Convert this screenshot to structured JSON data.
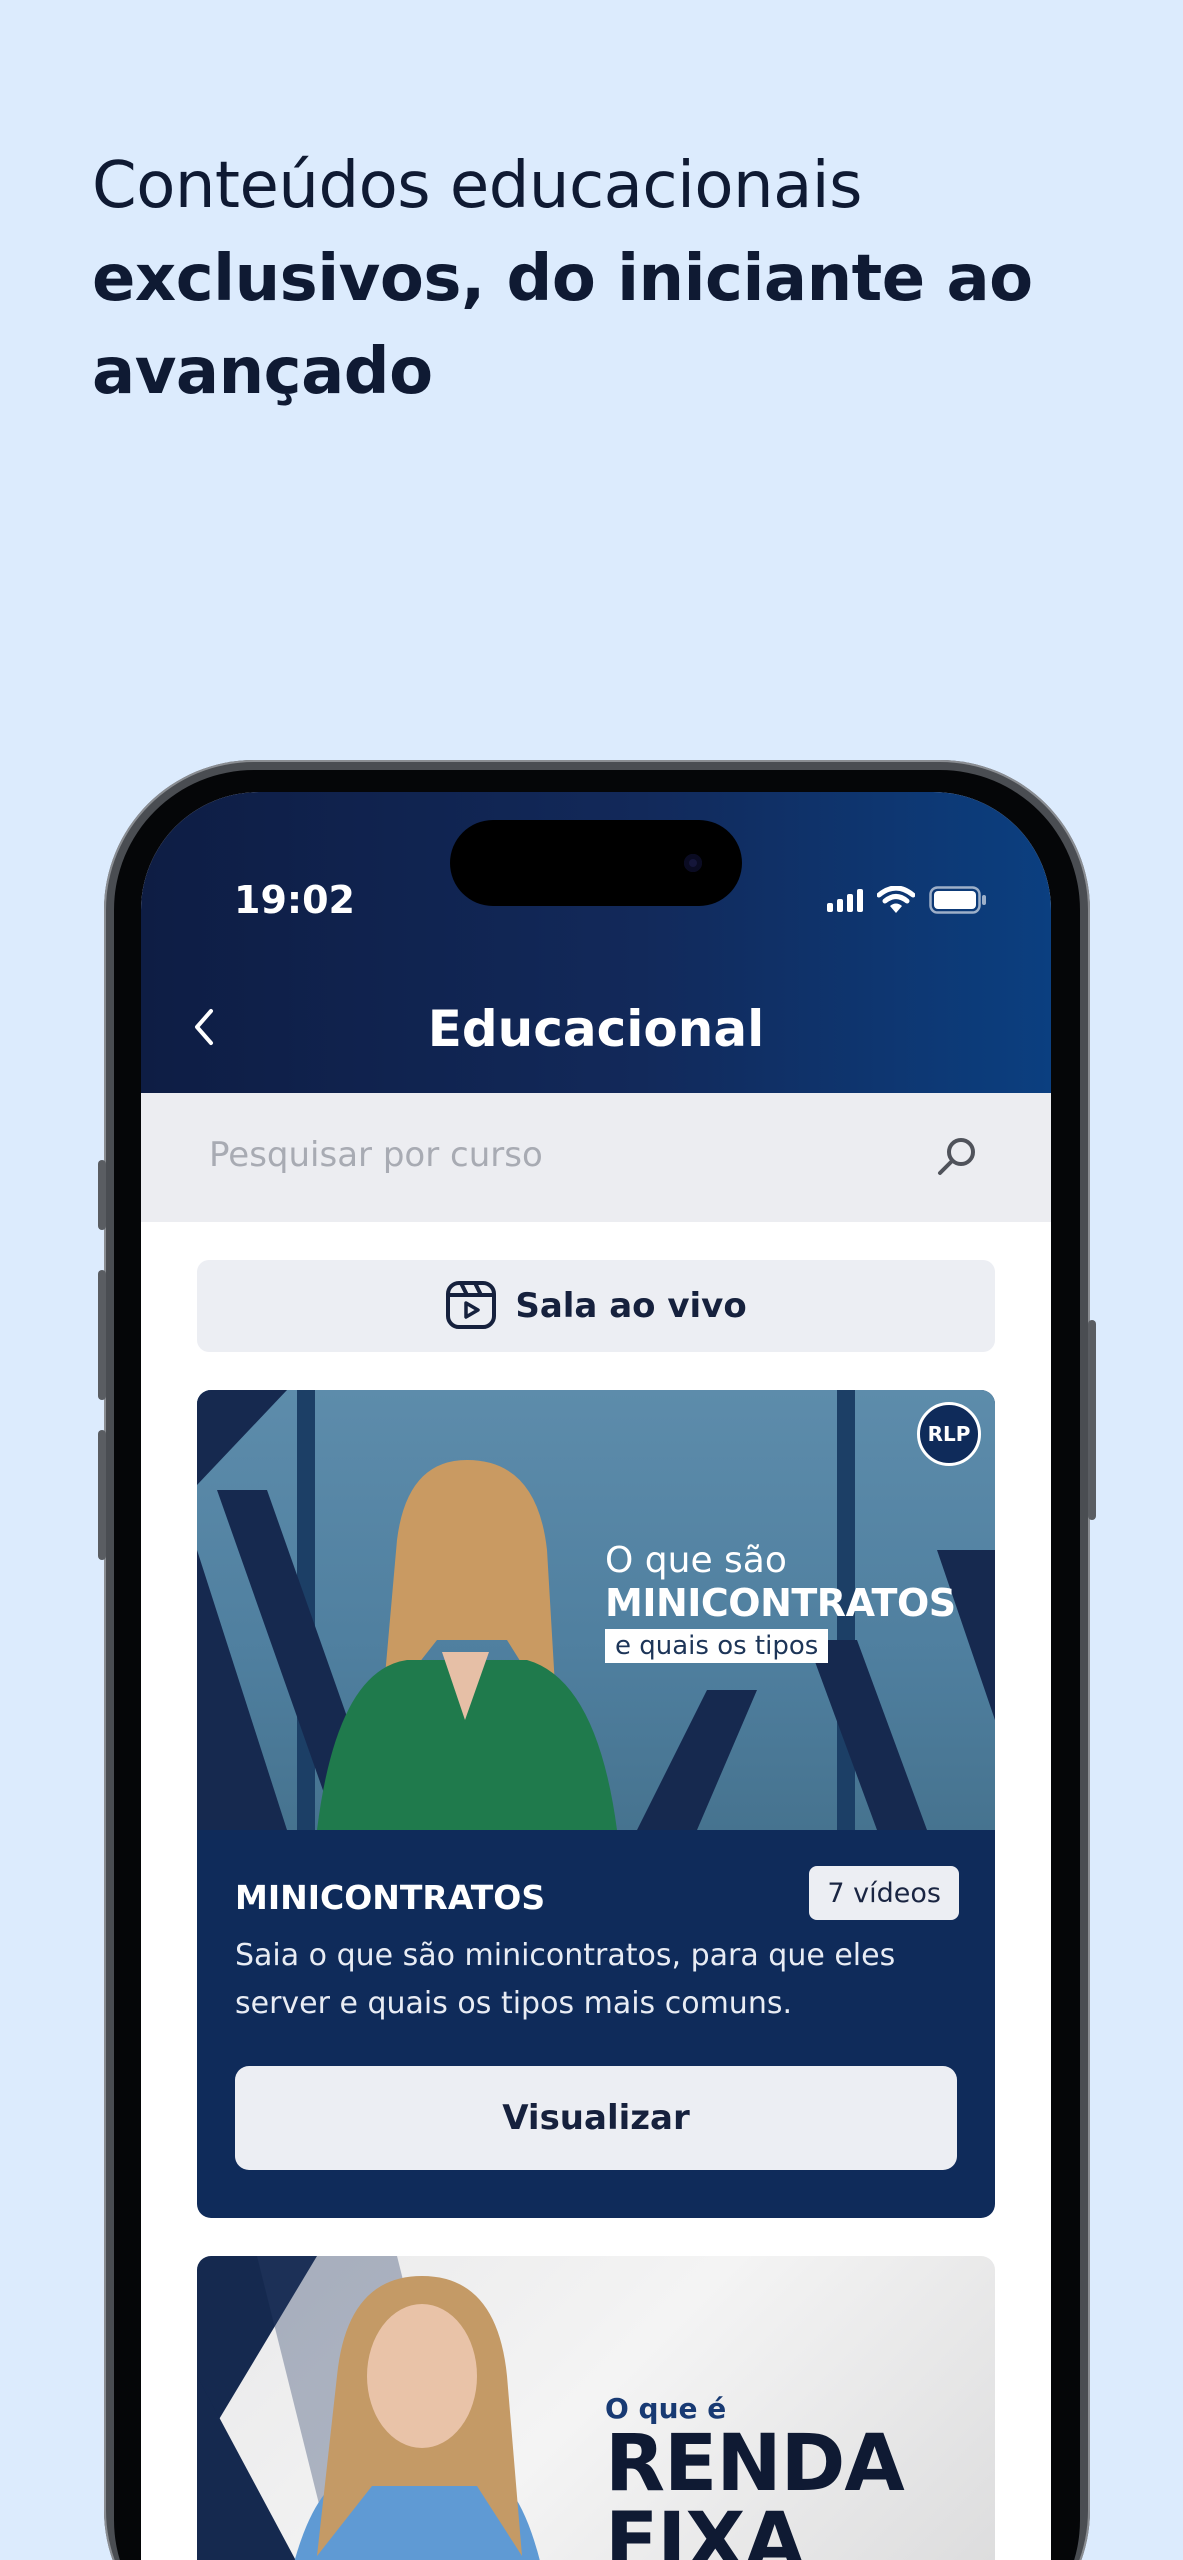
{
  "headline": {
    "line1": "Conteúdos educacionais",
    "line2": "exclusivos, do iniciante ao",
    "line3": "avançado"
  },
  "status_bar": {
    "time": "19:02",
    "icons": [
      "signal-icon",
      "wifi-icon",
      "battery-icon"
    ]
  },
  "nav": {
    "back_icon": "chevron-left-icon",
    "title": "Educacional"
  },
  "search": {
    "placeholder": "Pesquisar por curso",
    "icon": "search-icon"
  },
  "live_room": {
    "icon": "live-video-icon",
    "label": "Sala ao vivo"
  },
  "courses": [
    {
      "banner": {
        "line1": "O que são",
        "line2": "MINICONTRATOS",
        "line3": "e quais os tipos",
        "logo": "RLP"
      },
      "title": "MINICONTRATOS",
      "badge": "7 vídeos",
      "description": "Saia o que são minicontratos, para que eles server e quais os tipos mais comuns.",
      "button": "Visualizar"
    },
    {
      "banner": {
        "line1": "O que é",
        "line2": "RENDA",
        "line3": "FIXA"
      }
    }
  ],
  "colors": {
    "page_background": "#dcebfd",
    "header_dark": "#0e1d44",
    "header_light": "#0b3f80",
    "card_navy": "#0f2b5a",
    "button_light": "#eceef3"
  }
}
